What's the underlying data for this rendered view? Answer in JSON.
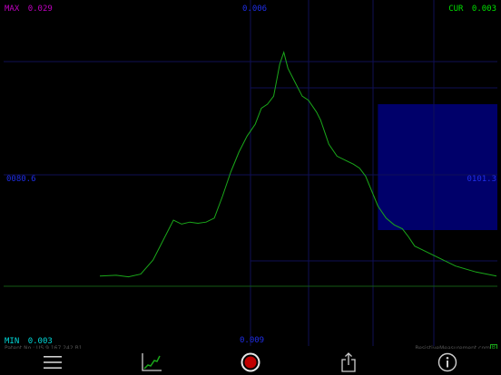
{
  "readouts": {
    "max_label": "MAX",
    "max_value": "0.029",
    "cur_label": "CUR",
    "cur_value": "0.003",
    "min_label": "MIN",
    "min_value": "0.003",
    "top_center": "0.006",
    "bottom_center": "0.009",
    "left_mid": "0080.6",
    "right_mid": "0101.3"
  },
  "footer": {
    "patent": "Patent No.: US 9,167,242 B1",
    "website": "ResistiveMeasurement.com",
    "badge": "B"
  },
  "toolbar": {
    "icons": [
      "menu-icon",
      "graph-icon",
      "record-icon",
      "share-icon",
      "info-icon"
    ]
  },
  "colors": {
    "max": "#c000c0",
    "cur": "#00e000",
    "min": "#00d8d8",
    "axis_text": "#1f2ee8",
    "trace": "#1aa81a",
    "selection": "#00006a",
    "grid": "#0f0f55",
    "record": "#c00000"
  },
  "chart_data": {
    "type": "line",
    "series": [
      {
        "values": [
          [
            0.18,
            0.003
          ],
          [
            0.22,
            0.0032
          ],
          [
            0.25,
            0.0028
          ],
          [
            0.28,
            0.0035
          ],
          [
            0.31,
            0.007
          ],
          [
            0.33,
            0.011
          ],
          [
            0.36,
            0.017
          ],
          [
            0.38,
            0.016
          ],
          [
            0.4,
            0.0165
          ],
          [
            0.42,
            0.0162
          ],
          [
            0.44,
            0.0165
          ],
          [
            0.46,
            0.0175
          ],
          [
            0.48,
            0.023
          ],
          [
            0.5,
            0.029
          ],
          [
            0.52,
            0.034
          ],
          [
            0.54,
            0.038
          ],
          [
            0.56,
            0.041
          ],
          [
            0.575,
            0.045
          ],
          [
            0.59,
            0.046
          ],
          [
            0.605,
            0.048
          ],
          [
            0.62,
            0.056
          ],
          [
            0.63,
            0.059
          ],
          [
            0.64,
            0.055
          ],
          [
            0.66,
            0.051
          ],
          [
            0.675,
            0.048
          ],
          [
            0.69,
            0.047
          ],
          [
            0.71,
            0.044
          ],
          [
            0.72,
            0.042
          ],
          [
            0.74,
            0.036
          ],
          [
            0.76,
            0.033
          ],
          [
            0.78,
            0.032
          ],
          [
            0.8,
            0.031
          ],
          [
            0.815,
            0.03
          ],
          [
            0.83,
            0.028
          ],
          [
            0.86,
            0.0205
          ],
          [
            0.88,
            0.0175
          ],
          [
            0.9,
            0.0158
          ],
          [
            0.92,
            0.0148
          ],
          [
            0.935,
            0.0128
          ],
          [
            0.95,
            0.0105
          ],
          [
            0.97,
            0.0095
          ],
          [
            1.0,
            0.008
          ],
          [
            1.05,
            0.0055
          ],
          [
            1.1,
            0.004
          ],
          [
            1.15,
            0.003
          ]
        ]
      }
    ],
    "grid": true,
    "selection_region": {
      "x": [
        0.86,
        1.15
      ],
      "y": [
        0.0145,
        0.046
      ]
    }
  }
}
